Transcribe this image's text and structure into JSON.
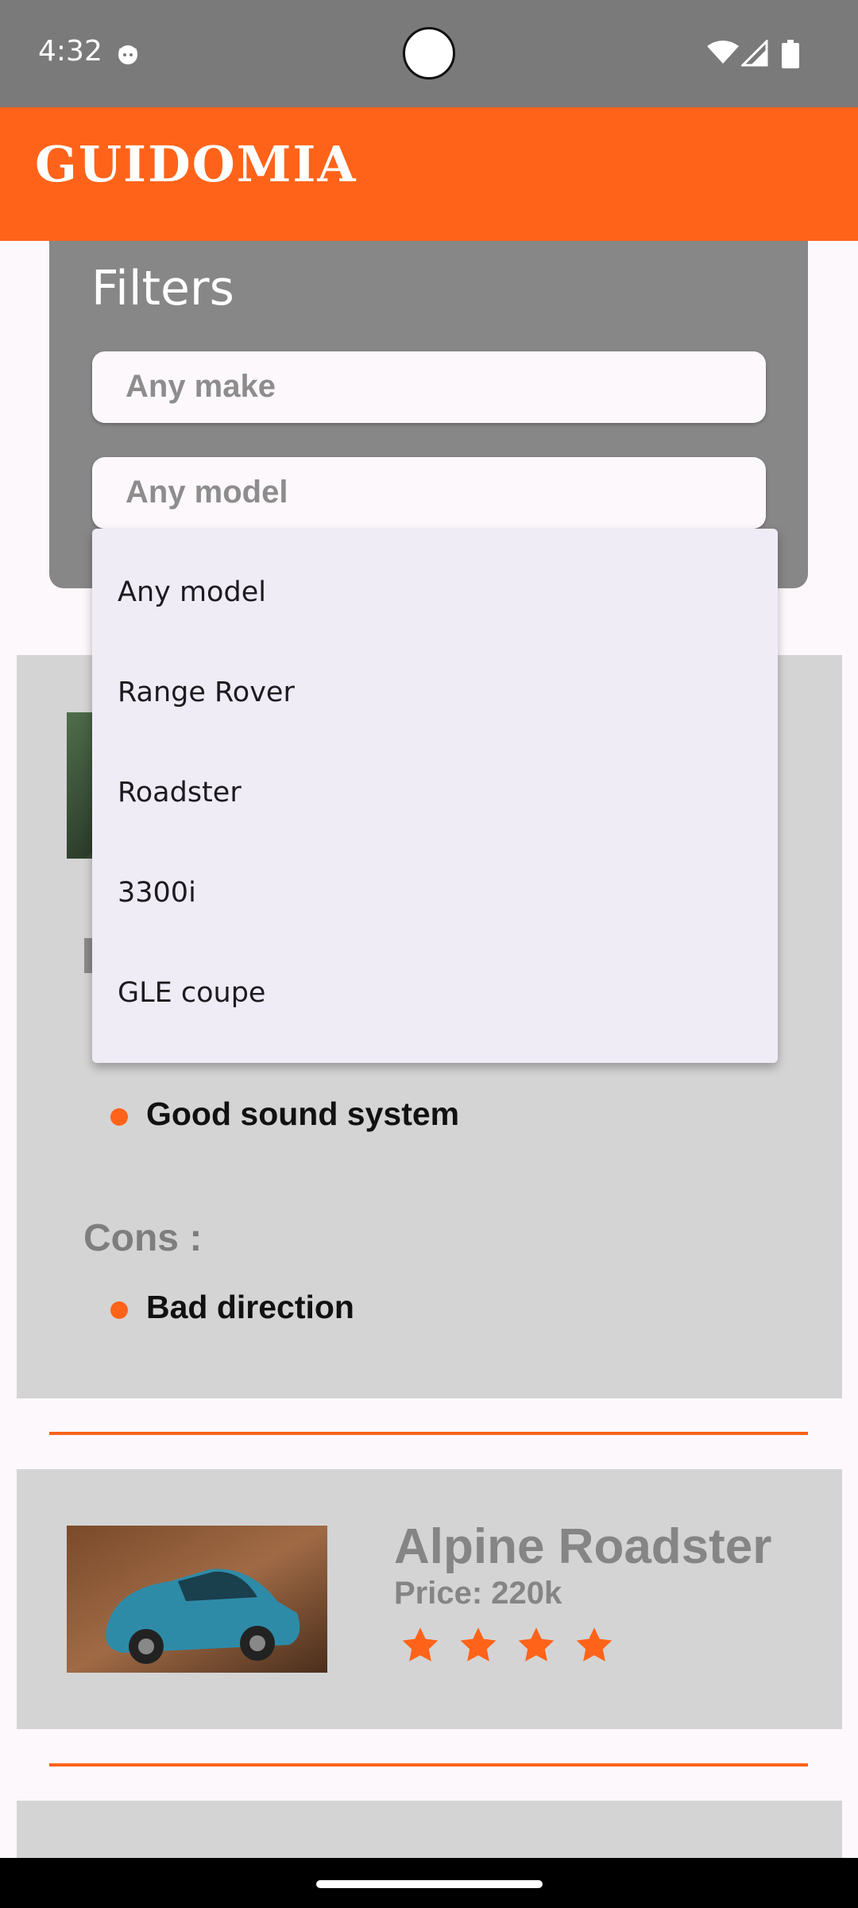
{
  "status_bar": {
    "time": "4:32"
  },
  "app_bar": {
    "title": "GUIDOMIA"
  },
  "filters": {
    "title": "Filters",
    "make_placeholder": "Any make",
    "model_placeholder": "Any model"
  },
  "dropdown": {
    "options": [
      "Any model",
      "Range Rover",
      "Roadster",
      "3300i",
      "GLE coupe"
    ]
  },
  "cars": [
    {
      "pros": [
        "Good sound system"
      ],
      "cons_label": "Cons :",
      "cons": [
        "Bad direction"
      ]
    },
    {
      "name": "Alpine Roadster",
      "price": "Price: 220k",
      "rating": 4
    }
  ],
  "colors": {
    "accent": "#FF6319",
    "status_bar": "#7A7A7A",
    "panel": "#878787",
    "card": "#D4D4D4"
  }
}
